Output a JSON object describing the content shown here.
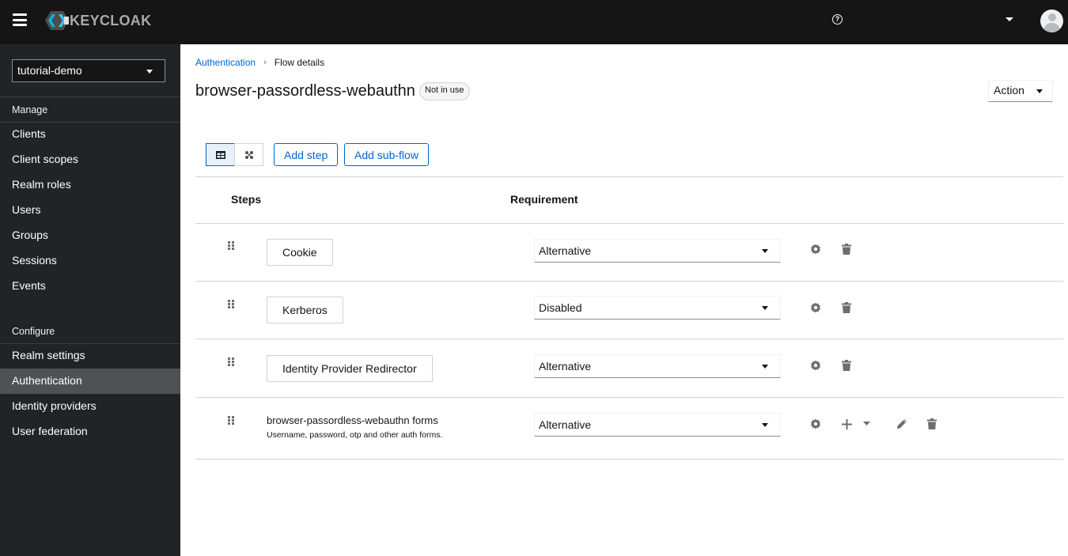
{
  "header": {
    "brand": "KEYCLOAK",
    "icons": {
      "menu": "hamburger-icon",
      "help": "question-circle-icon",
      "user_menu": "caret-down-icon",
      "avatar": "user-avatar-icon"
    },
    "help_glyph": "?"
  },
  "sidebar": {
    "realm": "tutorial-demo",
    "sections": [
      {
        "title": "Manage",
        "items": [
          {
            "label": "Clients"
          },
          {
            "label": "Client scopes"
          },
          {
            "label": "Realm roles"
          },
          {
            "label": "Users"
          },
          {
            "label": "Groups"
          },
          {
            "label": "Sessions"
          },
          {
            "label": "Events"
          }
        ]
      },
      {
        "title": "Configure",
        "items": [
          {
            "label": "Realm settings"
          },
          {
            "label": "Authentication",
            "active": true
          },
          {
            "label": "Identity providers"
          },
          {
            "label": "User federation"
          }
        ]
      }
    ]
  },
  "breadcrumb": {
    "parent": "Authentication",
    "separator": "›",
    "current": "Flow details"
  },
  "page": {
    "title": "browser-passordless-webauthn",
    "status_badge": "Not in use",
    "action_label": "Action"
  },
  "toolbar": {
    "view_toggle": [
      {
        "name": "table-view",
        "icon": "table-icon",
        "selected": true
      },
      {
        "name": "diagram-view",
        "icon": "topology-icon",
        "selected": false
      }
    ],
    "add_step_label": "Add step",
    "add_subflow_label": "Add sub-flow"
  },
  "table": {
    "headers": {
      "steps": "Steps",
      "requirement": "Requirement"
    },
    "rows": [
      {
        "type": "step",
        "name": "Cookie",
        "requirement": "Alternative",
        "actions": [
          "gear-icon",
          "trash-icon"
        ]
      },
      {
        "type": "step",
        "name": "Kerberos",
        "requirement": "Disabled",
        "actions": [
          "gear-icon",
          "trash-icon"
        ]
      },
      {
        "type": "step",
        "name": "Identity Provider Redirector",
        "requirement": "Alternative",
        "actions": [
          "gear-icon",
          "trash-icon"
        ]
      },
      {
        "type": "subflow",
        "name": "browser-passordless-webauthn forms",
        "description": "Username, password, otp and other auth forms.",
        "requirement": "Alternative",
        "actions": [
          "gear-icon",
          "plus-icon",
          "caret-down-icon",
          "pencil-icon",
          "trash-icon"
        ]
      }
    ]
  },
  "colors": {
    "topbar": "#151515",
    "sidebar": "#212427",
    "sidebar_active": "#4f5255",
    "link": "#0066cc",
    "icon_gray": "#6a6e73"
  }
}
